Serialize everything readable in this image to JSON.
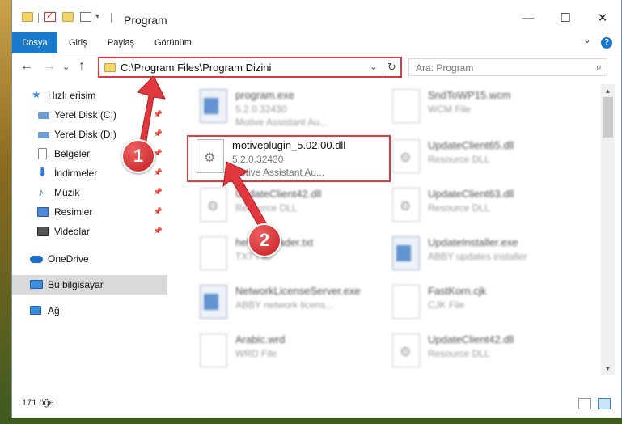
{
  "titlebar": {
    "title": "Program",
    "minimize": "—",
    "maximize": "☐",
    "close": "✕"
  },
  "ribbon": {
    "tabs": [
      "Dosya",
      "Giriş",
      "Paylaş",
      "Görünüm"
    ],
    "expand": "⌄",
    "help": "?"
  },
  "address": {
    "path": "C:\\Program Files\\Program Dizini",
    "back": "←",
    "forward": "→",
    "recent": "⌄",
    "up": "↑",
    "dropdown": "⌄",
    "refresh": "↻"
  },
  "search": {
    "placeholder": "Ara: Program",
    "icon": "⌕"
  },
  "sidebar": {
    "items": [
      {
        "label": "Hızlı erişim",
        "icon": "star-icon",
        "color": "#3c8de0"
      },
      {
        "label": "Yerel Disk (C:)",
        "icon": "drive-icon",
        "color": "#6b9fd6",
        "pinned": true
      },
      {
        "label": "Yerel Disk (D:)",
        "icon": "drive-icon",
        "color": "#6b9fd6",
        "pinned": true
      },
      {
        "label": "Belgeler",
        "icon": "documents-icon",
        "color": "#8a8a8a",
        "pinned": true
      },
      {
        "label": "İndirmeler",
        "icon": "downloads-icon",
        "color": "#2b7cd3",
        "pinned": true
      },
      {
        "label": "Müzik",
        "icon": "music-icon",
        "color": "#2b7cd3",
        "pinned": true
      },
      {
        "label": "Resimler",
        "icon": "pictures-icon",
        "color": "#4a8ad8",
        "pinned": true
      },
      {
        "label": "Videolar",
        "icon": "videos-icon",
        "color": "#555555",
        "pinned": true
      },
      {
        "label": "OneDrive",
        "icon": "cloud-icon",
        "color": "#1a6fc9"
      },
      {
        "label": "Bu bilgisayar",
        "icon": "computer-icon",
        "color": "#3b8de0",
        "selected": true
      },
      {
        "label": "Ağ",
        "icon": "network-icon",
        "color": "#3b8de0"
      }
    ],
    "pin_glyph": "📌"
  },
  "files": [
    {
      "name": "program.exe",
      "line2": "5.2.0.32430",
      "line3": "Motive Assistant Au...",
      "icon": "app-icon",
      "blurred": true
    },
    {
      "name": "SndToWP15.wcm",
      "line2": "WCM File",
      "line3": "",
      "icon": "file-icon",
      "blurred": true
    },
    {
      "name": "motiveplugin_5.02.00.dll",
      "line2": "5.2.0.32430",
      "line3": "Motive Assistant Au...",
      "icon": "dll-icon",
      "blurred": false
    },
    {
      "name": "UpdateClient65.dll",
      "line2": "Resource DLL",
      "line3": "",
      "icon": "dll-icon",
      "blurred": true
    },
    {
      "name": "UpdateClient42.dll",
      "line2": "Resource DLL",
      "line3": "",
      "icon": "dll-icon",
      "blurred": true
    },
    {
      "name": "UpdateClient63.dll",
      "line2": "Resource DLL",
      "line3": "",
      "icon": "dll-icon",
      "blurred": true
    },
    {
      "name": "helper_loader.txt",
      "line2": "TXT File",
      "line3": "",
      "icon": "file-icon",
      "blurred": true
    },
    {
      "name": "UpdateInstaller.exe",
      "line2": "ABBY updates installer",
      "line3": "",
      "icon": "app-icon",
      "blurred": true
    },
    {
      "name": "NetworkLicenseServer.exe",
      "line2": "ABBY network licens...",
      "line3": "",
      "icon": "app-icon",
      "blurred": true
    },
    {
      "name": "FastKorn.cjk",
      "line2": "CJK File",
      "line3": "",
      "icon": "file-icon",
      "blurred": true
    },
    {
      "name": "Arabic.wrd",
      "line2": "WRD File",
      "line3": "",
      "icon": "file-icon",
      "blurred": true
    },
    {
      "name": "UpdateClient42.dll",
      "line2": "Resource DLL",
      "line3": "",
      "icon": "dll-icon",
      "blurred": true
    }
  ],
  "status": {
    "count": "171 öğe"
  },
  "annotations": {
    "badge1": "1",
    "badge2": "2",
    "color": "#e0383e"
  }
}
